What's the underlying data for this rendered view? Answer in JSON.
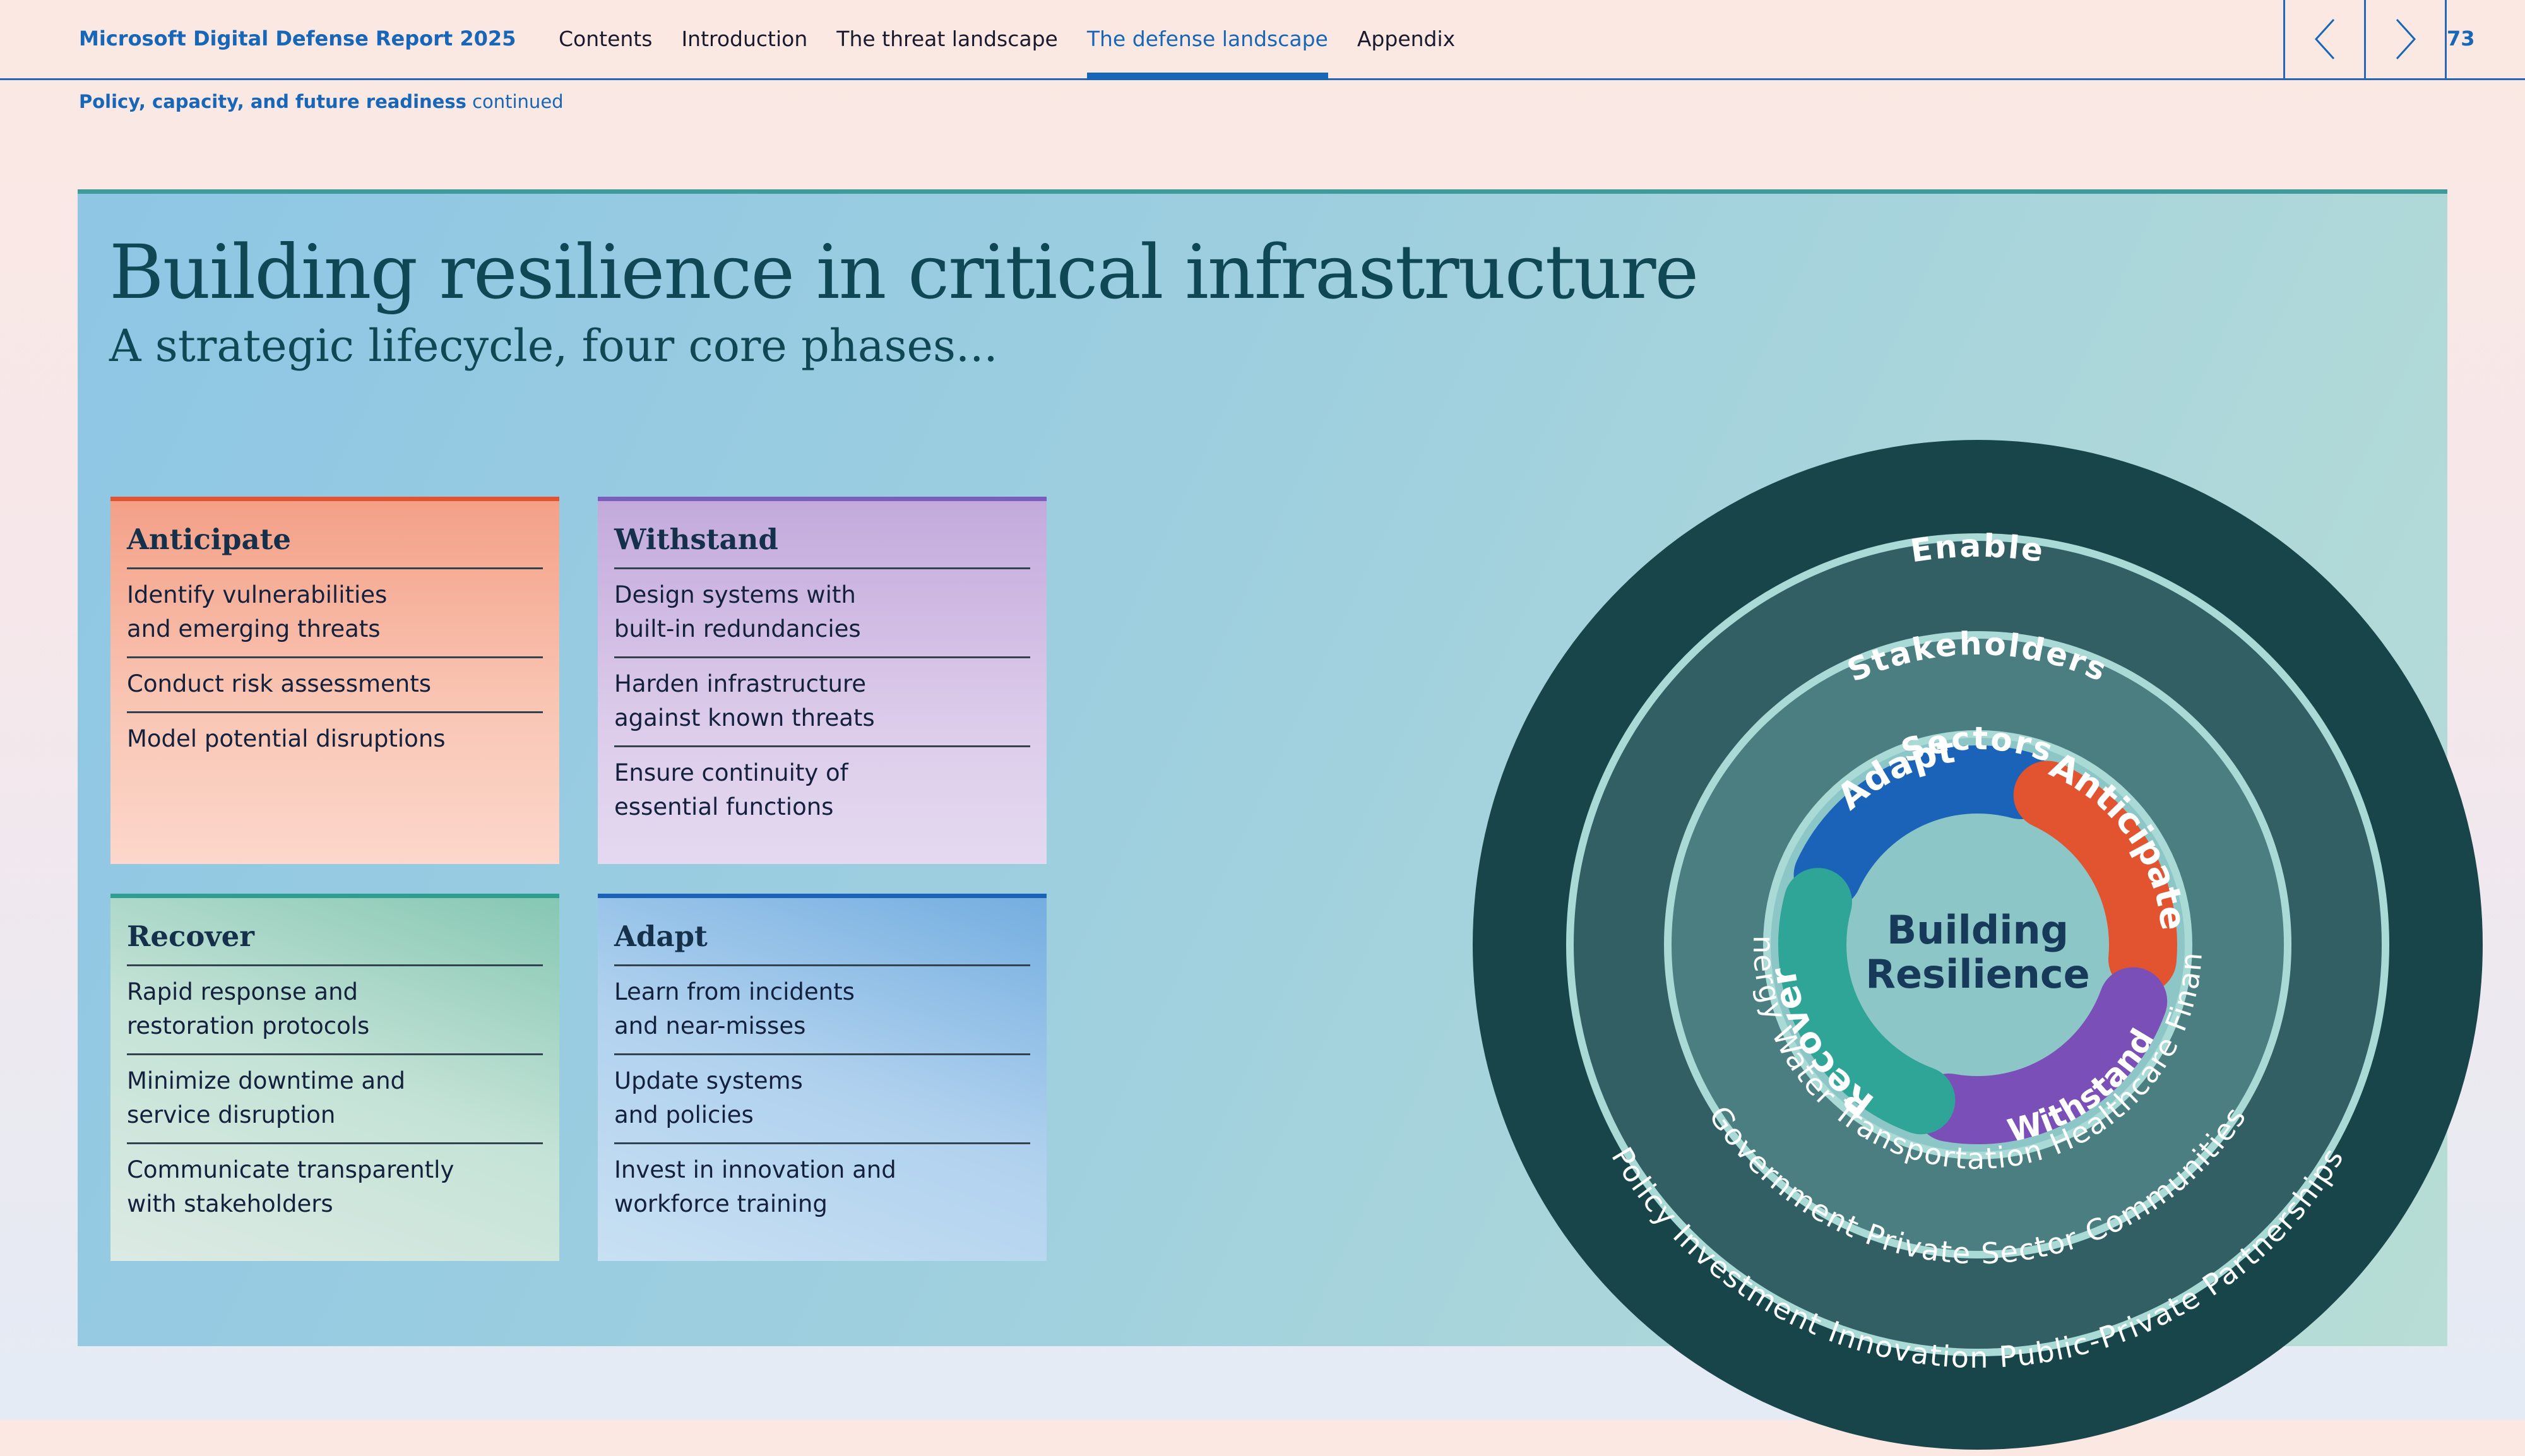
{
  "header": {
    "report_title": "Microsoft Digital Defense Report 2025",
    "nav": [
      {
        "label": "Contents"
      },
      {
        "label": "Introduction"
      },
      {
        "label": "The threat landscape"
      },
      {
        "label": "The defense landscape"
      },
      {
        "label": "Appendix"
      }
    ],
    "active_nav": "The defense landscape",
    "page_number": "73"
  },
  "breadcrumb": {
    "section": "Policy, capacity, and future readiness",
    "suffix": "continued"
  },
  "main": {
    "title": "Building resilience in critical infrastructure",
    "subtitle": "A strategic lifecycle, four core phases..."
  },
  "cards": {
    "anticipate": {
      "title": "Anticipate",
      "items": [
        "Identify vulnerabilities\nand emerging threats",
        "Conduct risk assessments",
        "Model potential disruptions"
      ]
    },
    "withstand": {
      "title": "Withstand",
      "items": [
        "Design systems with\nbuilt-in redundancies",
        "Harden infrastructure\nagainst known threats",
        "Ensure continuity of\nessential functions"
      ]
    },
    "recover": {
      "title": "Recover",
      "items": [
        "Rapid response and\nrestoration protocols",
        "Minimize downtime and\nservice disruption",
        "Communicate transparently\nwith stakeholders"
      ]
    },
    "adapt": {
      "title": "Adapt",
      "items": [
        "Learn from incidents\nand near-misses",
        "Update systems\nand policies",
        "Invest in innovation and\nworkforce training"
      ]
    }
  },
  "diagram": {
    "center": {
      "line1": "Building",
      "line2": "Resilience"
    },
    "phases": [
      {
        "label": "Adapt",
        "color": "#1b63b8"
      },
      {
        "label": "Anticipate",
        "color": "#e2532f"
      },
      {
        "label": "Withstand",
        "color": "#7b4fb8"
      },
      {
        "label": "Recover",
        "color": "#2ea596"
      }
    ],
    "rings": {
      "enable": {
        "label": "Enable",
        "items": "Policy  Investment  Innovation  Public-Private Partnerships"
      },
      "stakeholders": {
        "label": "Stakeholders",
        "items": "Government  Private Sector  Communities"
      },
      "sectors": {
        "label": "Sectors",
        "items": "Energy  Water  Transportation  Healthcare  Finance"
      }
    },
    "colors": {
      "outer": "#174549",
      "middle": "#325f63",
      "inner": "#4a7e80",
      "core": "#8cc6c6",
      "separator": "#a9dad6"
    }
  }
}
